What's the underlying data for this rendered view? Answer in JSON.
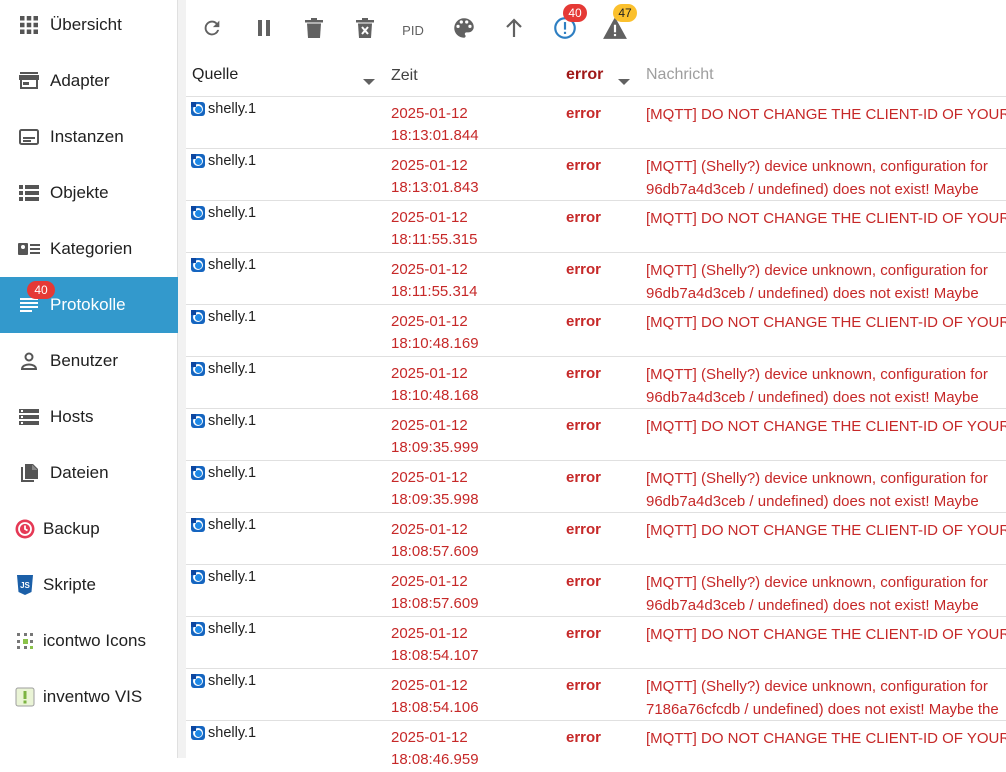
{
  "sidebar": {
    "items": [
      {
        "label": "Übersicht",
        "icon": "grid-icon"
      },
      {
        "label": "Adapter",
        "icon": "store-icon"
      },
      {
        "label": "Instanzen",
        "icon": "instances-icon"
      },
      {
        "label": "Objekte",
        "icon": "list-icon"
      },
      {
        "label": "Kategorien",
        "icon": "categories-icon"
      },
      {
        "label": "Protokolle",
        "icon": "log-icon",
        "badge": "40",
        "active": true
      },
      {
        "label": "Benutzer",
        "icon": "user-icon"
      },
      {
        "label": "Hosts",
        "icon": "hosts-icon"
      },
      {
        "label": "Dateien",
        "icon": "files-icon"
      },
      {
        "label": "Backup",
        "icon": "backup-icon"
      },
      {
        "label": "Skripte",
        "icon": "javascript-icon"
      },
      {
        "label": "icontwo Icons",
        "icon": "icontwo-icon"
      },
      {
        "label": "inventwo VIS",
        "icon": "inventwo-icon"
      }
    ]
  },
  "toolbar": {
    "pid_label": "PID",
    "error_count": "40",
    "warning_count": "47"
  },
  "table": {
    "headers": {
      "source": "Quelle",
      "time": "Zeit",
      "severity": "error",
      "message_placeholder": "Nachricht"
    },
    "rows": [
      {
        "source": "shelly.1",
        "date": "2025-01-12",
        "time": "18:13:01.844",
        "severity": "error",
        "msg1": "[MQTT] DO NOT CHANGE THE CLIENT-ID OF YOUR",
        "msg2": ""
      },
      {
        "source": "shelly.1",
        "date": "2025-01-12",
        "time": "18:13:01.843",
        "severity": "error",
        "msg1": "[MQTT] (Shelly?) device unknown, configuration for",
        "msg2": "96db7a4d3ceb / undefined) does not exist! Maybe"
      },
      {
        "source": "shelly.1",
        "date": "2025-01-12",
        "time": "18:11:55.315",
        "severity": "error",
        "msg1": "[MQTT] DO NOT CHANGE THE CLIENT-ID OF YOUR",
        "msg2": ""
      },
      {
        "source": "shelly.1",
        "date": "2025-01-12",
        "time": "18:11:55.314",
        "severity": "error",
        "msg1": "[MQTT] (Shelly?) device unknown, configuration for",
        "msg2": "96db7a4d3ceb / undefined) does not exist! Maybe"
      },
      {
        "source": "shelly.1",
        "date": "2025-01-12",
        "time": "18:10:48.169",
        "severity": "error",
        "msg1": "[MQTT] DO NOT CHANGE THE CLIENT-ID OF YOUR",
        "msg2": ""
      },
      {
        "source": "shelly.1",
        "date": "2025-01-12",
        "time": "18:10:48.168",
        "severity": "error",
        "msg1": "[MQTT] (Shelly?) device unknown, configuration for",
        "msg2": "96db7a4d3ceb / undefined) does not exist! Maybe"
      },
      {
        "source": "shelly.1",
        "date": "2025-01-12",
        "time": "18:09:35.999",
        "severity": "error",
        "msg1": "[MQTT] DO NOT CHANGE THE CLIENT-ID OF YOUR",
        "msg2": ""
      },
      {
        "source": "shelly.1",
        "date": "2025-01-12",
        "time": "18:09:35.998",
        "severity": "error",
        "msg1": "[MQTT] (Shelly?) device unknown, configuration for",
        "msg2": "96db7a4d3ceb / undefined) does not exist! Maybe"
      },
      {
        "source": "shelly.1",
        "date": "2025-01-12",
        "time": "18:08:57.609",
        "severity": "error",
        "msg1": "[MQTT] DO NOT CHANGE THE CLIENT-ID OF YOUR",
        "msg2": ""
      },
      {
        "source": "shelly.1",
        "date": "2025-01-12",
        "time": "18:08:57.609",
        "severity": "error",
        "msg1": "[MQTT] (Shelly?) device unknown, configuration for",
        "msg2": "96db7a4d3ceb / undefined) does not exist! Maybe"
      },
      {
        "source": "shelly.1",
        "date": "2025-01-12",
        "time": "18:08:54.107",
        "severity": "error",
        "msg1": "[MQTT] DO NOT CHANGE THE CLIENT-ID OF YOUR",
        "msg2": ""
      },
      {
        "source": "shelly.1",
        "date": "2025-01-12",
        "time": "18:08:54.106",
        "severity": "error",
        "msg1": "[MQTT] (Shelly?) device unknown, configuration for",
        "msg2": "7186a76cfcdb / undefined) does not exist! Maybe the"
      },
      {
        "source": "shelly.1",
        "date": "2025-01-12",
        "time": "18:08:46.959",
        "severity": "error",
        "msg1": "[MQTT] DO NOT CHANGE THE CLIENT-ID OF YOUR",
        "msg2": ""
      }
    ]
  }
}
